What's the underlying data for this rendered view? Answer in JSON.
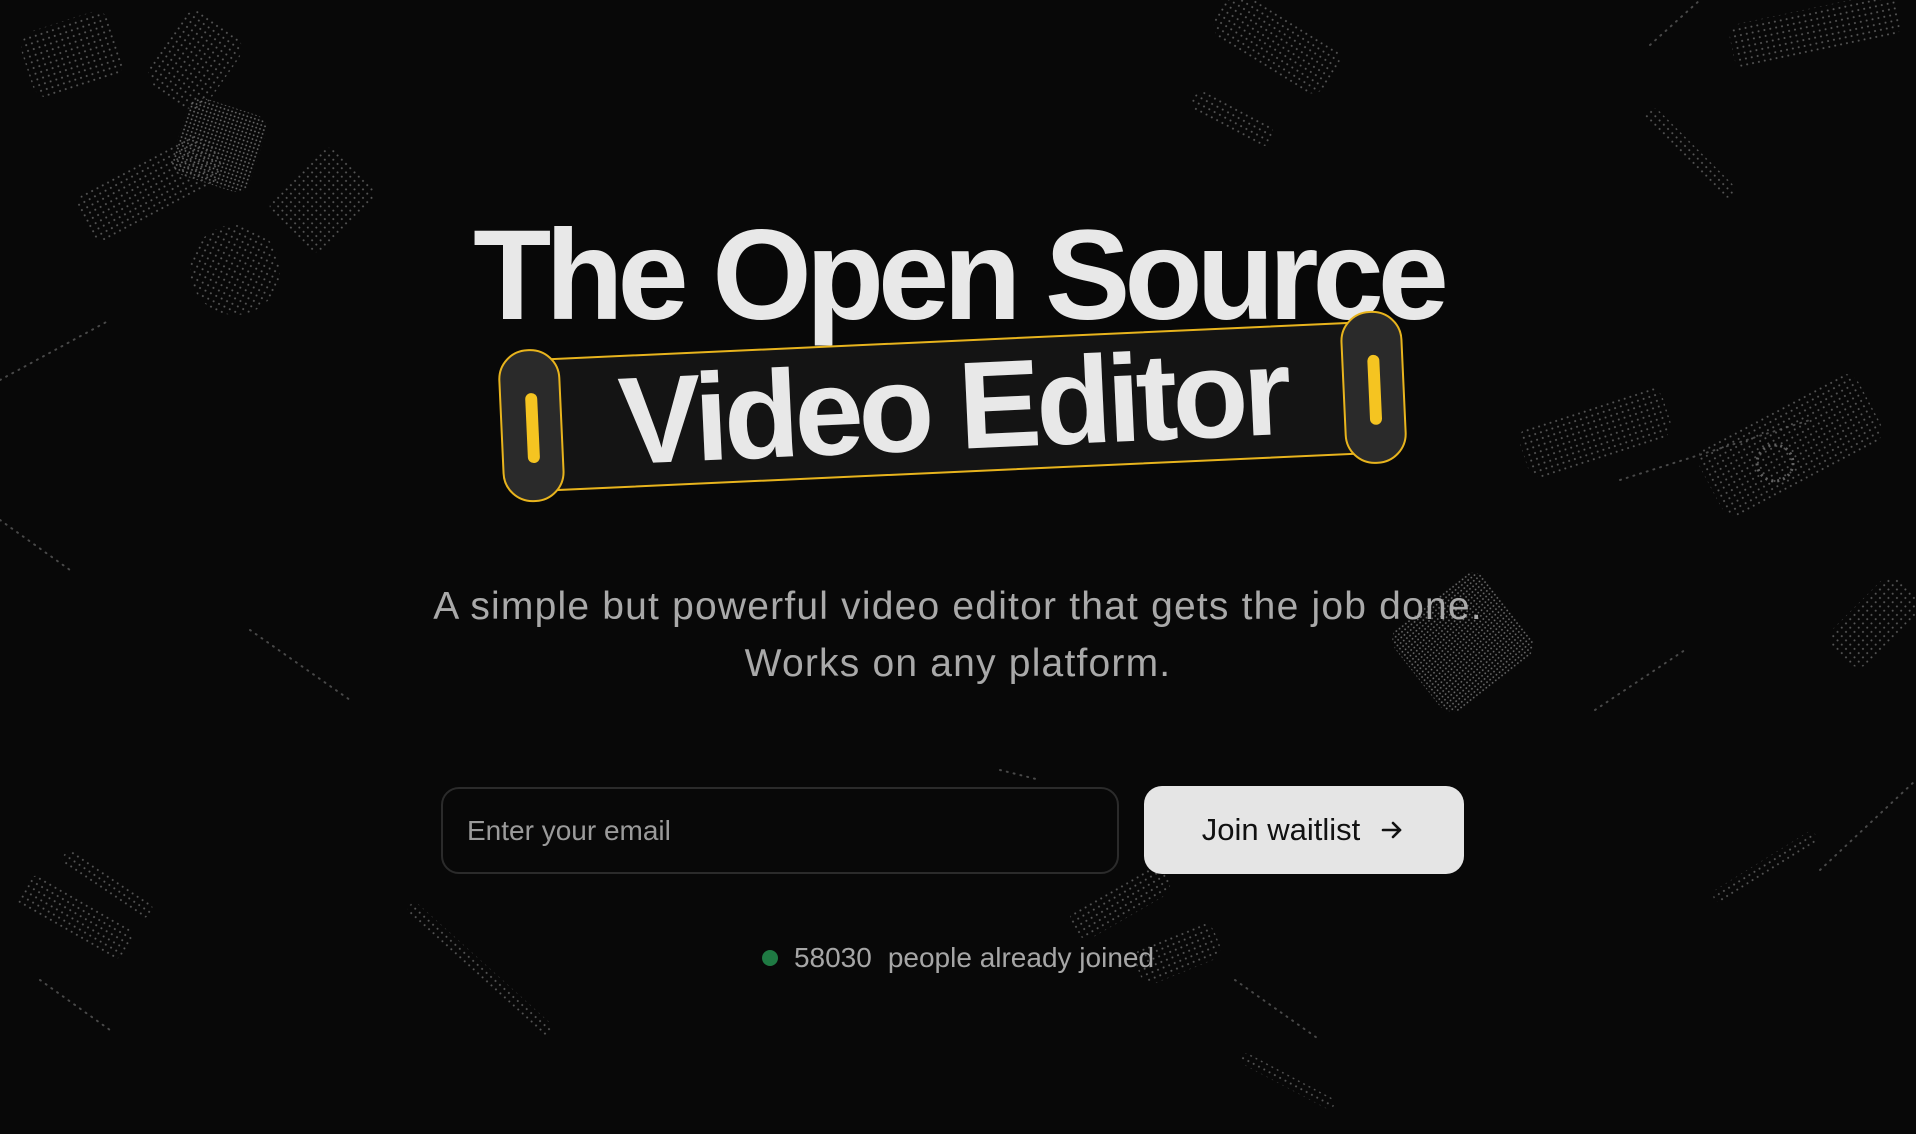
{
  "hero": {
    "title_line_1": "The Open Source",
    "title_line_2": "Video Editor",
    "subtitle_line_1": "A simple but powerful video editor that gets the job done.",
    "subtitle_line_2": "Works on any platform."
  },
  "waitlist": {
    "email_placeholder": "Enter your email",
    "button_label": "Join waitlist",
    "button_icon": "arrow-right-icon",
    "joined_count": "58030",
    "joined_text": "people already joined",
    "status_color": "#1f7a43"
  },
  "theme": {
    "background": "#080808",
    "accent": "#f5c421",
    "button_background": "#e5e5e5"
  }
}
